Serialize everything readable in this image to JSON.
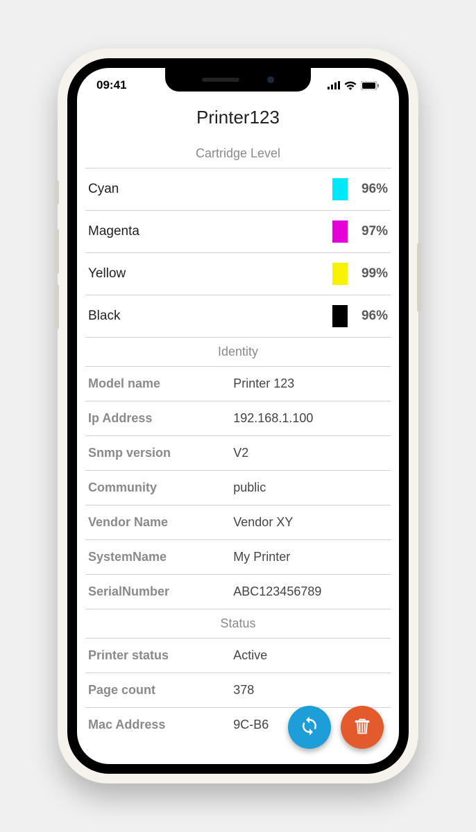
{
  "statusbar": {
    "time": "09:41"
  },
  "header": {
    "title": "Printer123"
  },
  "sections": {
    "cartridge_header": "Cartridge Level",
    "identity_header": "Identity",
    "status_header": "Status"
  },
  "cartridges": [
    {
      "label": "Cyan",
      "pct": "96%",
      "color": "#00e8f8"
    },
    {
      "label": "Magenta",
      "pct": "97%",
      "color": "#e400d8"
    },
    {
      "label": "Yellow",
      "pct": "99%",
      "color": "#f7f300"
    },
    {
      "label": "Black",
      "pct": "96%",
      "color": "#000000"
    }
  ],
  "identity": [
    {
      "key": "Model name",
      "val": "Printer 123"
    },
    {
      "key": "Ip Address",
      "val": "192.168.1.100"
    },
    {
      "key": "Snmp version",
      "val": "V2"
    },
    {
      "key": "Community",
      "val": "public"
    },
    {
      "key": "Vendor Name",
      "val": "Vendor XY"
    },
    {
      "key": "SystemName",
      "val": "My Printer"
    },
    {
      "key": "SerialNumber",
      "val": "ABC123456789"
    }
  ],
  "status": [
    {
      "key": "Printer status",
      "val": "Active"
    },
    {
      "key": "Page count",
      "val": "378"
    },
    {
      "key": "Mac Address",
      "val": "9C-B6"
    }
  ]
}
